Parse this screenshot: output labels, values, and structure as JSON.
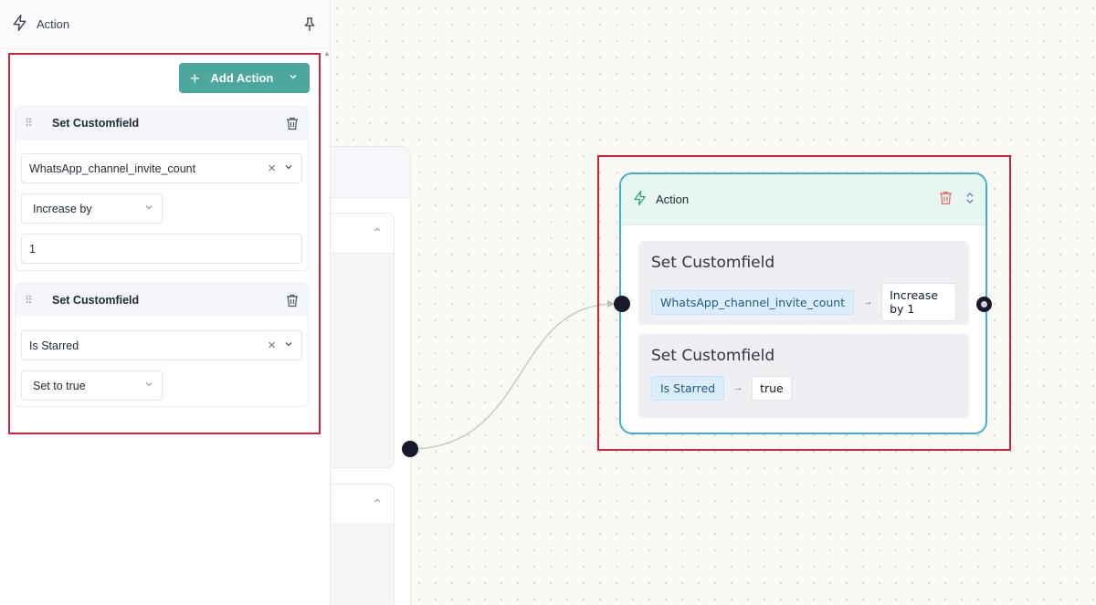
{
  "left_panel": {
    "header": {
      "title": "Action",
      "icon": "lightning-icon",
      "pin_icon": "pin-icon"
    },
    "add_action_label": "Add Action",
    "actions": [
      {
        "name": "Set Customfield",
        "field": "WhatsApp_channel_invite_count",
        "operation": "Increase by",
        "value": "1"
      },
      {
        "name": "Set Customfield",
        "field": "Is Starred",
        "operation": "Set to true"
      }
    ]
  },
  "node": {
    "title": "Action",
    "cards": [
      {
        "title": "Set Customfield",
        "field": "WhatsApp_channel_invite_count",
        "arrow": "→",
        "value": "Increase by 1"
      },
      {
        "title": "Set Customfield",
        "field": "Is Starred",
        "arrow": "→",
        "value": "true"
      }
    ]
  },
  "colors": {
    "accent_teal": "#4ca79c",
    "node_border": "#3fb3c4",
    "highlight_red": "#d1233a",
    "delete_red": "#e86a6a"
  }
}
